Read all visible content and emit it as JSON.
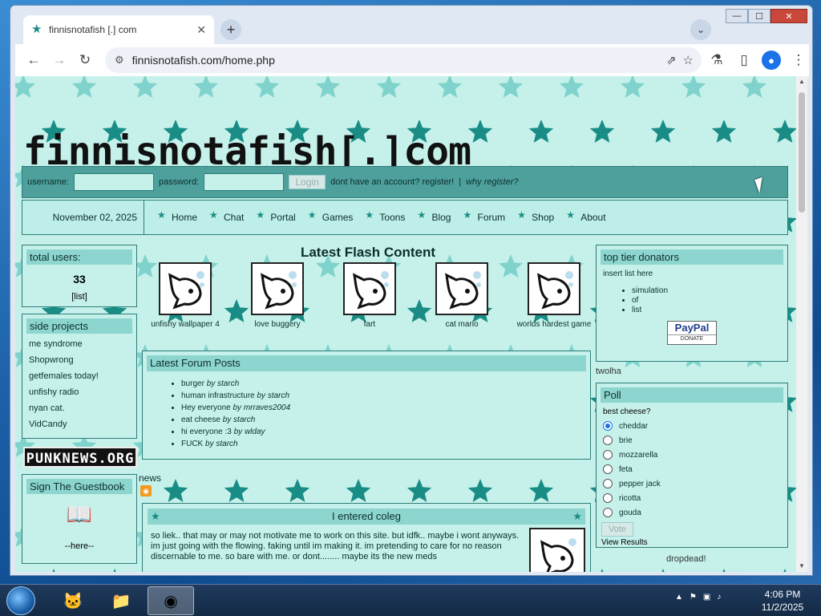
{
  "browser": {
    "tab_title": "finnisnotafish [.] com",
    "tab_close": "✕",
    "new_tab": "+",
    "tab_search": "⌄",
    "url": "finnisnotafish.com/home.php",
    "window_controls": {
      "minimize": "—",
      "maximize": "☐",
      "close": "✕"
    }
  },
  "site": {
    "logo": "finnisnotafish[.]com",
    "login": {
      "username_label": "username:",
      "password_label": "password:",
      "login_button": "Login",
      "register_text": "dont have an account? register!",
      "separator": "|",
      "why_register": "why register?"
    },
    "date": "November 02, 2025",
    "nav": [
      "Home",
      "Chat",
      "Portal",
      "Games",
      "Toons",
      "Blog",
      "Forum",
      "Shop",
      "About"
    ]
  },
  "left": {
    "total_users": {
      "title": "total users:",
      "count": "33",
      "list_link": "[list]"
    },
    "side_projects": {
      "title": "side projects",
      "items": [
        "me syndrome",
        "Shopwrong",
        "getfemales today!",
        "unfishy radio",
        "nyan cat.",
        "VidCandy"
      ]
    },
    "punknews": "PUNKNEWS.ORG",
    "guestbook": {
      "title": "Sign The Guestbook",
      "link": "--here--"
    }
  },
  "center": {
    "flash_title": "Latest Flash Content",
    "flash_items": [
      "unfishy wallpaper 4",
      "love buggery",
      "fart",
      "cat mario",
      "worlds hardest game"
    ],
    "forum": {
      "title": "Latest Forum Posts",
      "posts": [
        {
          "title": "burger",
          "by": "by starch"
        },
        {
          "title": "human infrastructure",
          "by": "by starch"
        },
        {
          "title": "Hey everyone",
          "by": "by mrraves2004"
        },
        {
          "title": "eat cheese",
          "by": "by starch"
        },
        {
          "title": "hi everyone :3",
          "by": "by wlday"
        },
        {
          "title": "FUCK",
          "by": "by starch"
        }
      ]
    },
    "news_label": "news",
    "article": {
      "title": "I entered coleg",
      "body": "so liek.. that may or may not motivate me to work on this site. but idfk.. maybe i wont anyways. im just going with the flowing. faking until im making it. im pretending to care for no reason discernable to me. so bare with me. or dont........ maybe its the new meds"
    }
  },
  "right": {
    "donators": {
      "title": "top tier donators",
      "text": "insert list here",
      "items": [
        "simulation",
        "of",
        "list"
      ],
      "paypal": "PayPal",
      "donate": "DONATE"
    },
    "broken_img_1": "twolha",
    "poll": {
      "title": "Poll",
      "question": "best cheese?",
      "options": [
        "cheddar",
        "brie",
        "mozzarella",
        "feta",
        "pepper jack",
        "ricotta",
        "gouda"
      ],
      "vote_button": "Vote",
      "view_results": "View Results"
    },
    "broken_img_2": "dropdead!"
  },
  "taskbar": {
    "time": "4:06 PM",
    "date": "11/2/2025"
  }
}
